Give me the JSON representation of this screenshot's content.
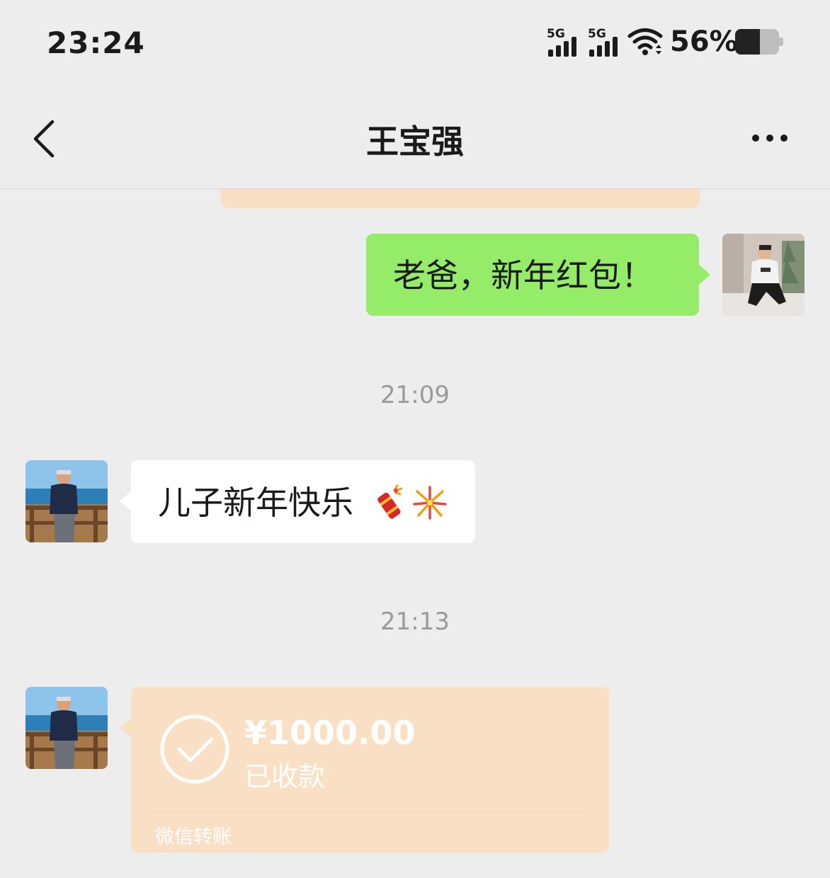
{
  "status_bar": {
    "time": "23:24",
    "signal1_label": "5G",
    "signal2_label": "5G",
    "battery_percent_text": "56%",
    "battery_level": 0.56
  },
  "nav": {
    "title": "王宝强"
  },
  "messages": {
    "me_text": "老爸，新年红包！",
    "time1": "21:09",
    "dad_text": "儿子新年快乐",
    "time2": "21:13",
    "transfer": {
      "amount": "¥1000.00",
      "status": "已收款",
      "footer": "微信转账"
    }
  },
  "colors": {
    "background": "#ededed",
    "my_bubble": "#95ec69",
    "other_bubble": "#ffffff",
    "transfer_card": "#f9dfc3"
  },
  "icons": [
    "back-arrow-icon",
    "more-icon",
    "wifi-icon",
    "signal-icon",
    "battery-icon",
    "check-circle-icon",
    "firecracker-emoji",
    "fireworks-emoji"
  ]
}
